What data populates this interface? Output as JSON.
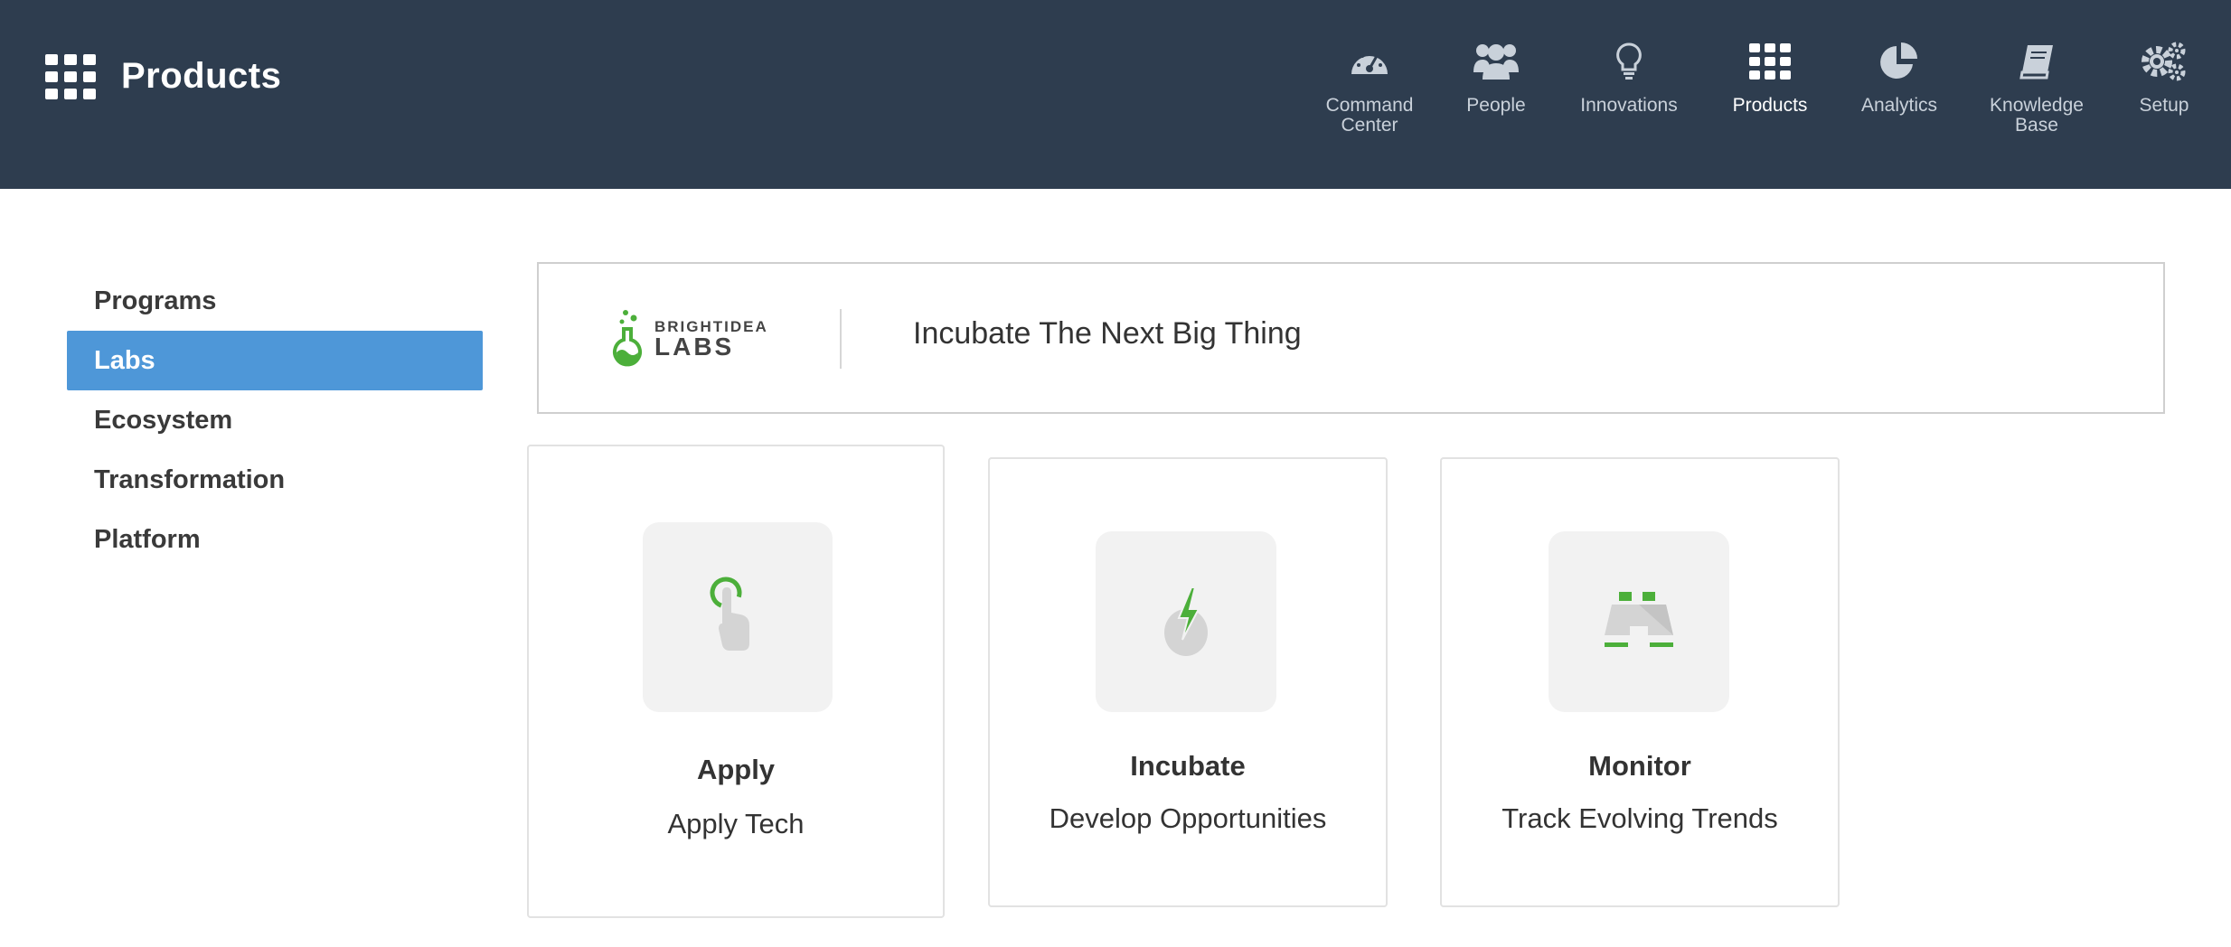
{
  "header": {
    "title": "Products",
    "background": "#2e3d4f",
    "nav": [
      {
        "label": "Command\nCenter",
        "icon": "speedometer-icon"
      },
      {
        "label": "People",
        "icon": "people-icon"
      },
      {
        "label": "Innovations",
        "icon": "lightbulb-icon"
      },
      {
        "label": "Products",
        "icon": "grid-icon",
        "active": true
      },
      {
        "label": "Analytics",
        "icon": "pie-chart-icon"
      },
      {
        "label": "Knowledge\nBase",
        "icon": "book-icon"
      },
      {
        "label": "Setup",
        "icon": "gears-icon"
      }
    ]
  },
  "sidebar": {
    "items": [
      {
        "label": "Programs"
      },
      {
        "label": "Labs",
        "active": true
      },
      {
        "label": "Ecosystem"
      },
      {
        "label": "Transformation"
      },
      {
        "label": "Platform"
      }
    ],
    "active_color": "#4e97d8"
  },
  "banner": {
    "logo_small": "BRIGHTIDEA",
    "logo_big": "LABS",
    "tagline": "Incubate The Next Big Thing"
  },
  "cards": [
    {
      "title": "Apply",
      "subtitle": "Apply Tech",
      "icon": "touch-hand-icon"
    },
    {
      "title": "Incubate",
      "subtitle": "Develop Opportunities",
      "icon": "egg-lightning-icon"
    },
    {
      "title": "Monitor",
      "subtitle": "Track Evolving Trends",
      "icon": "binoculars-icon"
    }
  ],
  "accent_green": "#4caf3a"
}
